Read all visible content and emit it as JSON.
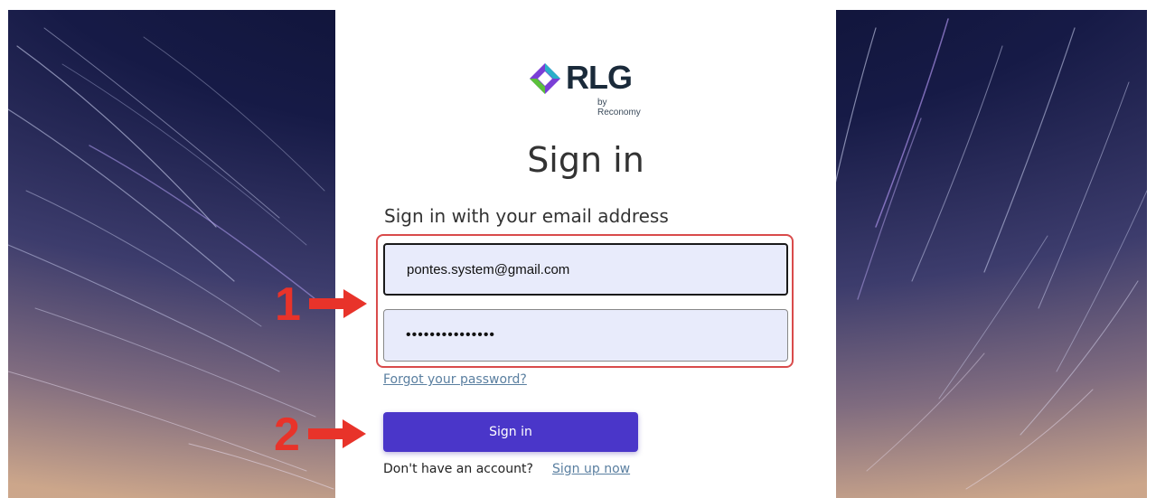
{
  "brand": {
    "wordmark": "RLG",
    "tagline": "by Reconomy"
  },
  "page": {
    "title": "Sign in",
    "subtitle": "Sign in with your email address"
  },
  "form": {
    "email_value": "pontes.system@gmail.com",
    "password_value": "•••••••••••••••",
    "forgot_label": "Forgot your password?",
    "submit_label": "Sign in",
    "no_account_text": "Don't have an account?",
    "signup_label": "Sign up now"
  },
  "annotations": {
    "step1": "1",
    "step2": "2"
  },
  "colors": {
    "accent": "#4a36c9",
    "annotation_red": "#e8332a",
    "field_bg": "#e8ebfb",
    "link": "#5a7fa0"
  }
}
